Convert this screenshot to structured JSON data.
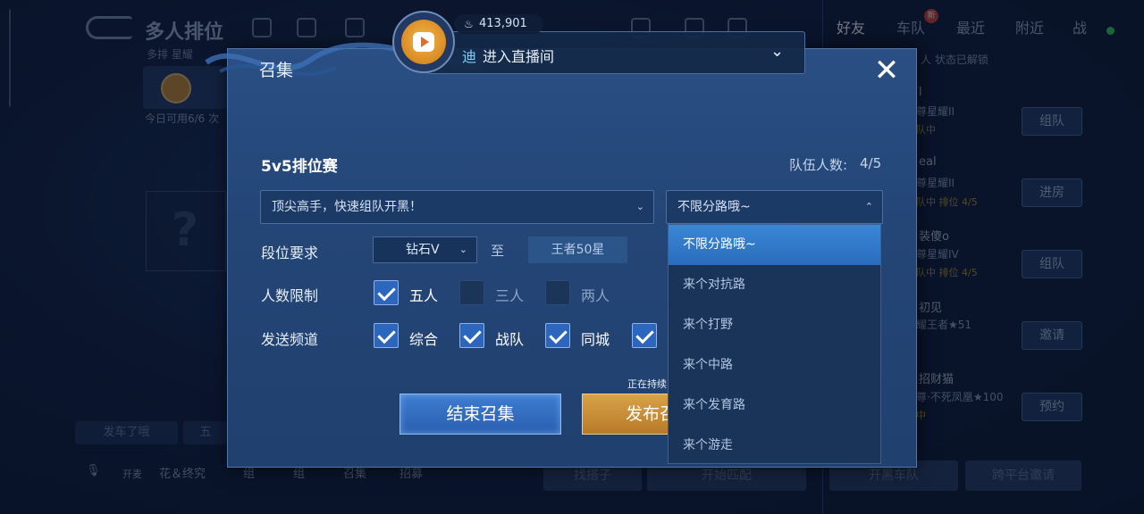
{
  "lobby": {
    "mode_title": "多人排位",
    "mode_sub": "多排 星耀",
    "available": "今日可用6/6 次",
    "bottom_left_btn": "发车了哦",
    "bottom_left_btn2": "五",
    "voice_label": "花＆终究",
    "mic_status": "开麦",
    "team_tools": [
      "组",
      "组",
      "召集",
      "招募"
    ],
    "find_partner": "找搭子",
    "start_match": "开始匹配",
    "team_recruit": "开黑车队",
    "cross_platform": "跨平台邀请"
  },
  "friends": {
    "tabs": [
      "好友",
      "车队",
      "最近",
      "附近",
      "战"
    ],
    "unlock_status": "人 状态已解锁",
    "list": [
      {
        "name": "l",
        "rank": "尊星耀II",
        "status": "队中",
        "button": "组队"
      },
      {
        "name": "eal",
        "rank": "尊星耀II",
        "status": "队中 排位 4/5",
        "button": "进房"
      },
      {
        "name": "装傻o",
        "rank": "尊星耀IV",
        "status": "队中 排位 4/5",
        "button": "组队"
      },
      {
        "name": "初见",
        "rank": "耀王者★51",
        "status": "",
        "button": "邀请"
      },
      {
        "name": "招财猫",
        "rank": "尊·不死凤凰★100",
        "status": "中",
        "button": "预约"
      }
    ],
    "new_badge": "新"
  },
  "live": {
    "viewer_count": "413,901",
    "user": "迪",
    "enter_text": "进入直播间"
  },
  "modal": {
    "title": "召集",
    "close": "✕",
    "game_mode": "5v5排位赛",
    "team_count_label": "队伍人数:",
    "team_count_value": "4/5",
    "slogan": "顶尖高手，快速组队开黑！",
    "lane_selected": "不限分路哦~",
    "rank_label": "段位要求",
    "rank_min": "钻石V",
    "rank_to": "至",
    "rank_max": "王者50星",
    "size_label": "人数限制",
    "sizes": [
      {
        "label": "五人",
        "checked": true
      },
      {
        "label": "三人",
        "checked": false
      },
      {
        "label": "两人",
        "checked": false
      }
    ],
    "channel_label": "发送频道",
    "channels": [
      {
        "label": "综合",
        "checked": true
      },
      {
        "label": "战队",
        "checked": true
      },
      {
        "label": "同城",
        "checked": true
      },
      {
        "label": "",
        "checked": true
      }
    ],
    "ongoing_note": "正在持续",
    "end_button": "结束召集",
    "publish_button": "发布召集"
  },
  "lane_options": [
    "不限分路哦~",
    "来个对抗路",
    "来个打野",
    "来个中路",
    "来个发育路",
    "来个游走"
  ],
  "colors": {
    "modal_bg": "#244677",
    "selected_option": "#2b6cbc",
    "end_button": "#2a5fb0",
    "publish_button": "#c58a30",
    "online": "#3ad264"
  }
}
